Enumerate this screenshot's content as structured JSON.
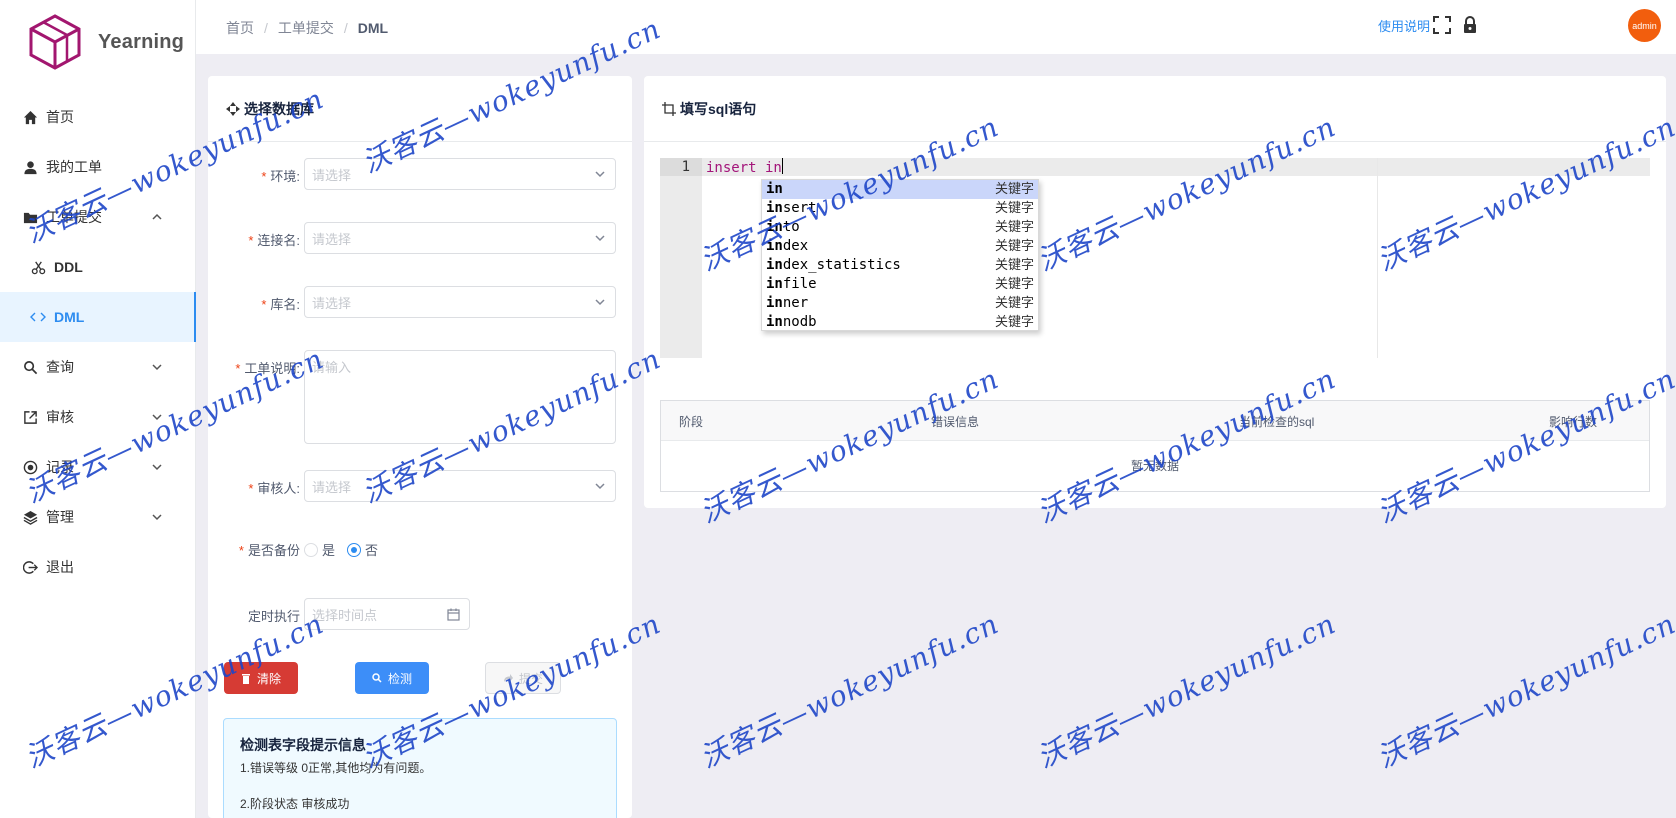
{
  "app": {
    "name": "Yearning"
  },
  "sidebar": {
    "items": [
      {
        "label": "首页",
        "icon": "home-icon"
      },
      {
        "label": "我的工单",
        "icon": "user-icon"
      },
      {
        "label": "工单提交",
        "icon": "folder-icon",
        "expanded": true
      },
      {
        "label": "DDL",
        "icon": "scissors-icon"
      },
      {
        "label": "DML",
        "icon": "code-icon",
        "active": true
      },
      {
        "label": "查询",
        "icon": "search-icon"
      },
      {
        "label": "审核",
        "icon": "external-link-icon"
      },
      {
        "label": "记录",
        "icon": "record-icon"
      },
      {
        "label": "管理",
        "icon": "layers-icon"
      },
      {
        "label": "退出",
        "icon": "logout-icon"
      }
    ]
  },
  "header": {
    "breadcrumb": [
      "首页",
      "工单提交",
      "DML"
    ],
    "help": "使用说明",
    "avatar": "admin"
  },
  "left_panel": {
    "title": "选择数据库",
    "env_label": "环境:",
    "env_placeholder": "请选择",
    "conn_label": "连接名:",
    "conn_placeholder": "请选择",
    "db_label": "库名:",
    "db_placeholder": "请选择",
    "desc_label": "工单说明:",
    "desc_placeholder": "请输入",
    "auditor_label": "审核人:",
    "auditor_placeholder": "请选择",
    "backup_label": "是否备份",
    "backup_yes": "是",
    "backup_no": "否",
    "schedule_label": "定时执行",
    "schedule_placeholder": "选择时间点",
    "btn_clear": "清除",
    "btn_check": "检测",
    "btn_submit": "提交",
    "info_title": "检测表字段提示信息",
    "info_lines": [
      "1.错误等级 0正常,其他均为有问题。",
      "2.阶段状态 审核成功"
    ]
  },
  "right_panel": {
    "title": "填写sql语句",
    "line_number": "1",
    "code": "insert in",
    "autocomplete": [
      {
        "prefix": "in",
        "rest": "",
        "meta": "关键字"
      },
      {
        "prefix": "in",
        "rest": "sert",
        "meta": "关键字"
      },
      {
        "prefix": "in",
        "rest": "to",
        "meta": "关键字"
      },
      {
        "prefix": "in",
        "rest": "dex",
        "meta": "关键字"
      },
      {
        "prefix": "in",
        "rest": "dex_statistics",
        "meta": "关键字"
      },
      {
        "prefix": "in",
        "rest": "file",
        "meta": "关键字"
      },
      {
        "prefix": "in",
        "rest": "ner",
        "meta": "关键字"
      },
      {
        "prefix": "in",
        "rest": "nodb",
        "meta": "关键字"
      }
    ],
    "table": {
      "columns": [
        "阶段",
        "错误信息",
        "当前检查的sql",
        "影响行数"
      ],
      "empty": "暂无数据"
    }
  },
  "watermark": "沃客云—wokeyunfu.cn",
  "colors": {
    "accent": "#2d8cf0",
    "danger": "#d63b34",
    "required": "#ed4014",
    "avatar": "#f25e0d",
    "watermark": "#1e46c8"
  }
}
